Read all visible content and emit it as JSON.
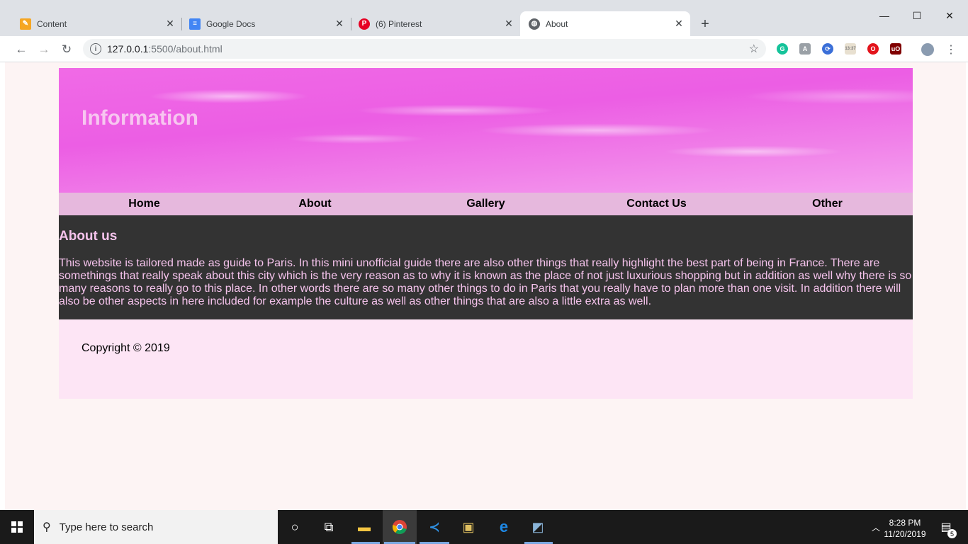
{
  "browser": {
    "tabs": [
      {
        "title": "Content",
        "icon": "content-favicon",
        "active": false
      },
      {
        "title": "Google Docs",
        "icon": "google-docs-favicon",
        "active": false
      },
      {
        "title": "(6) Pinterest",
        "icon": "pinterest-favicon",
        "active": false
      },
      {
        "title": "About",
        "icon": "globe-favicon",
        "active": true
      }
    ],
    "new_tab": "+",
    "window_controls": {
      "minimize": "—",
      "maximize": "☐",
      "close": "✕"
    },
    "address": {
      "host": "127.0.0.1",
      "path": ":5500/about.html"
    },
    "extensions": [
      "grammarly-icon",
      "font-icon",
      "sync-icon",
      "time-extension-icon",
      "opera-vpn-icon",
      "ublock-icon",
      "profile-avatar-icon"
    ]
  },
  "page": {
    "banner_title": "Information",
    "nav": [
      "Home",
      "About",
      "Gallery",
      "Contact Us",
      "Other"
    ],
    "about_heading": "About us",
    "about_text": "This website is tailored made as guide to Paris. In this mini unofficial guide there are also other things that really highlight the best part of being in France. There are somethings that really speak about this city which is the very reason as to why it is known as the place of not just luxurious shopping but in addition as well why there is so many reasons to really go to this place. In other words there are so many other things to do in Paris that you really have to plan more than one visit. In addition there will also be other aspects in here included for example the culture as well as other things that are also a little extra as well.",
    "footer": "Copyright © 2019"
  },
  "taskbar": {
    "search_placeholder": "Type here to search",
    "time": "8:28 PM",
    "date": "11/20/2019",
    "notifications": "5",
    "pinned": [
      "cortana-icon",
      "task-view-icon",
      "file-explorer-icon",
      "chrome-icon",
      "vscode-icon",
      "filezilla-icon",
      "edge-icon",
      "notepad-icon"
    ]
  },
  "colors": {
    "banner_pink": "#ec5ee4",
    "nav_bg": "#e6b8dd",
    "content_bg": "#333333",
    "content_text": "#f5c3ec",
    "footer_bg": "#fde5f5",
    "page_bg": "#fdf4f4"
  }
}
